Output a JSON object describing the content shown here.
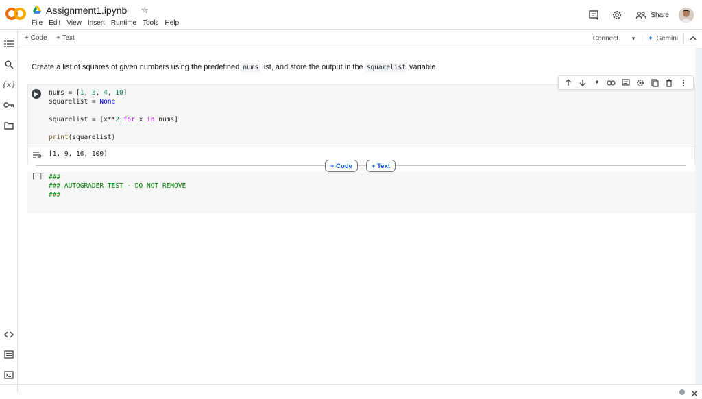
{
  "header": {
    "title": "Assignment1.ipynb",
    "menu": [
      "File",
      "Edit",
      "View",
      "Insert",
      "Runtime",
      "Tools",
      "Help"
    ],
    "share_label": "Share"
  },
  "toolbar": {
    "add_code": "+ Code",
    "add_text": "+ Text",
    "connect": "Connect",
    "gemini": "Gemini"
  },
  "markdown": {
    "part1": "Create a list of squares of given numbers using the predefined ",
    "code1": "nums",
    "part2": " list, and store the output in the ",
    "code2": "squarelist",
    "part3": " variable."
  },
  "cell1": {
    "line1_a": "nums = [",
    "n1": "1",
    "n2": "3",
    "n3": "4",
    "n4": "10",
    "line2_a": "squarelist = ",
    "none": "None",
    "line3_a": "squarelist = [x**",
    "two": "2",
    "kw_for": "for",
    "line3_b": " x ",
    "kw_in": "in",
    "line3_c": " nums]",
    "print": "print",
    "line4_b": "(squarelist)",
    "output": "[1, 9, 16, 100]"
  },
  "insert": {
    "code": "+ Code",
    "text": "+ Text"
  },
  "cell2": {
    "bracket": "[ ]",
    "line1": "###",
    "line2": "### AUTOGRADER TEST - DO NOT REMOVE",
    "line3": "###"
  },
  "colors": {
    "accent": "#0b57d0",
    "logo_orange": "#f9ab00",
    "logo_dark_orange": "#e8710a"
  }
}
